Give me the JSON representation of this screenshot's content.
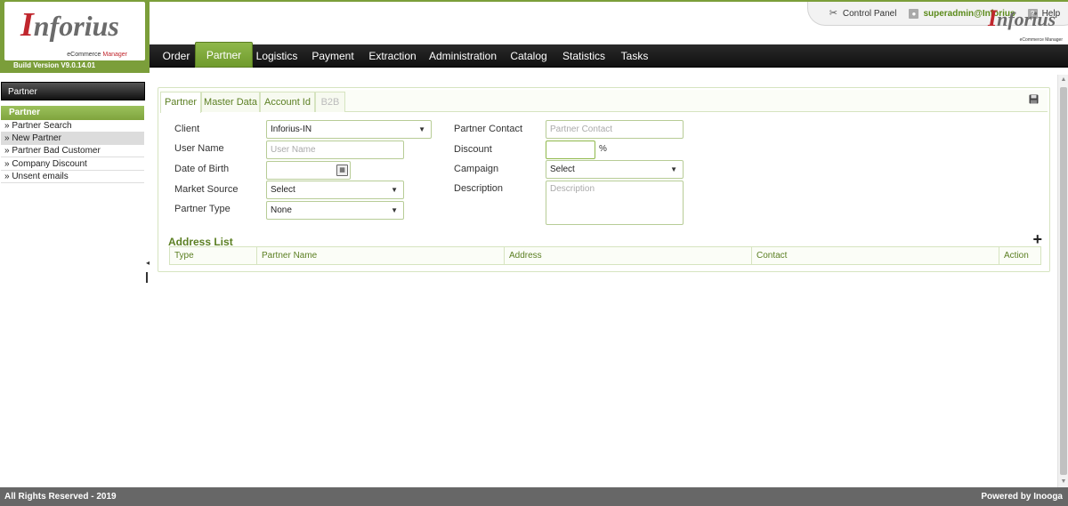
{
  "brand": {
    "logo_initial": "I",
    "logo_rest": "nforius",
    "logo_sub": "eCommerce",
    "logo_sub_accent": "Manager",
    "build_version": "Build Version V9.0.14.01"
  },
  "top_links": {
    "control_panel": "Control Panel",
    "user": "superadmin@Inforius",
    "help": "Help"
  },
  "nav": {
    "items": [
      {
        "label": "Order"
      },
      {
        "label": "Partner"
      },
      {
        "label": "Logistics"
      },
      {
        "label": "Payment"
      },
      {
        "label": "Extraction"
      },
      {
        "label": "Administration"
      },
      {
        "label": "Catalog"
      },
      {
        "label": "Statistics"
      },
      {
        "label": "Tasks"
      }
    ],
    "active": "Partner"
  },
  "sidebar": {
    "title": "Partner",
    "group": "Partner",
    "items": [
      {
        "label": "» Partner Search"
      },
      {
        "label": "» New Partner"
      },
      {
        "label": "» Partner Bad Customer"
      },
      {
        "label": "» Company Discount"
      },
      {
        "label": "» Unsent emails"
      }
    ],
    "selected": "New Partner"
  },
  "tabs": [
    {
      "label": "Partner"
    },
    {
      "label": "Master Data"
    },
    {
      "label": "Account Id"
    },
    {
      "label": "B2B"
    }
  ],
  "form": {
    "client": {
      "label": "Client",
      "value": "Inforius-IN"
    },
    "user_name": {
      "label": "User Name",
      "placeholder": "User Name"
    },
    "dob": {
      "label": "Date of Birth",
      "value": ""
    },
    "market_source": {
      "label": "Market Source",
      "value": "Select"
    },
    "partner_type": {
      "label": "Partner Type",
      "value": "None"
    },
    "partner_contact": {
      "label": "Partner Contact",
      "placeholder": "Partner Contact"
    },
    "discount": {
      "label": "Discount",
      "value": "",
      "unit": "%"
    },
    "campaign": {
      "label": "Campaign",
      "value": "Select"
    },
    "description": {
      "label": "Description",
      "placeholder": "Description"
    }
  },
  "address_list": {
    "title": "Address List",
    "add_icon": "+",
    "columns": [
      "Type",
      "Partner Name",
      "Address",
      "Contact",
      "Action"
    ]
  },
  "footer": {
    "left": "All Rights Reserved - 2019",
    "right": "Powered by Inooga"
  }
}
